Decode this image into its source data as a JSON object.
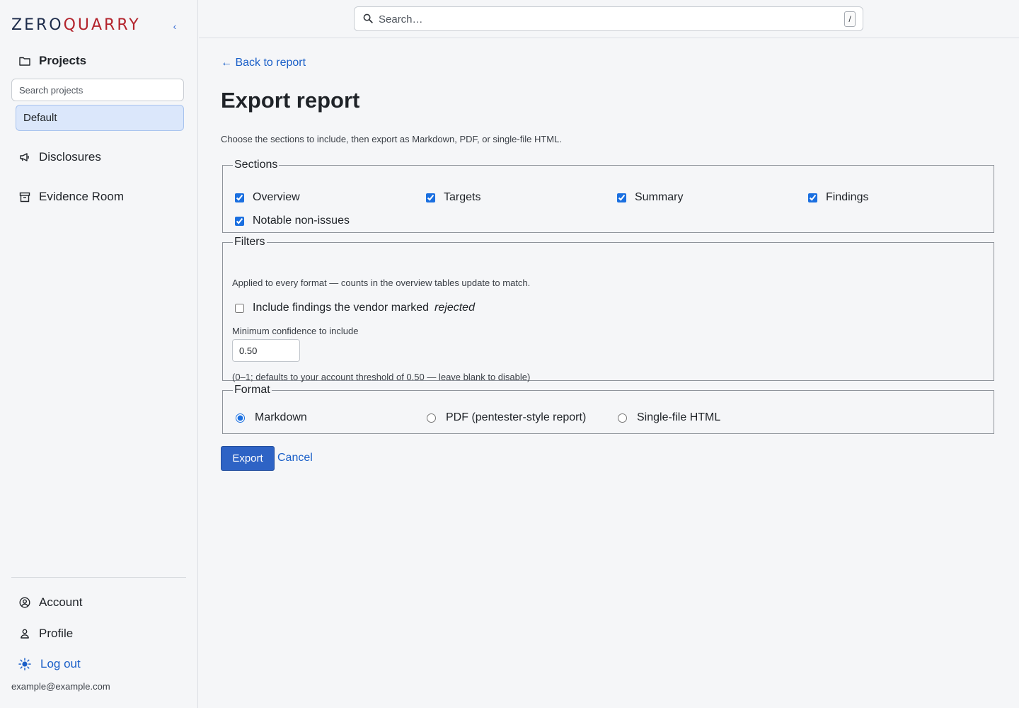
{
  "brand": {
    "zero": "ZERO",
    "quarry": "QUARRY",
    "collapse_glyph": "‹"
  },
  "sidebar": {
    "projects_label": "Projects",
    "project_search_placeholder": "Search projects",
    "projects": [
      {
        "label": "Default",
        "selected": true
      }
    ],
    "disclosures_label": "Disclosures",
    "evidence_room_label": "Evidence Room",
    "account_label": "Account",
    "profile_label": "Profile",
    "logout_label": "Log out",
    "user_email": "example@example.com"
  },
  "topbar": {
    "search_placeholder": "Search…",
    "shortcut_key": "/"
  },
  "main": {
    "back_link": "← Back to report",
    "title": "Export report",
    "intro": "Choose the sections to include, then export as Markdown, PDF, or single-file HTML.",
    "sections": {
      "legend": "Sections",
      "items": [
        {
          "label": "Overview",
          "checked": true
        },
        {
          "label": "Targets",
          "checked": true
        },
        {
          "label": "Summary",
          "checked": true
        },
        {
          "label": "Findings",
          "checked": true
        },
        {
          "label": "Notable non-issues",
          "checked": true
        }
      ]
    },
    "filters": {
      "legend": "Filters",
      "note": "Applied to every format — counts in the overview tables update to match.",
      "include_rejected_label": "Include findings the vendor marked",
      "include_rejected_emphasis": "rejected",
      "include_rejected_checked": false,
      "min_confidence_label": "Minimum confidence to include",
      "min_confidence_value": "0.50",
      "min_confidence_help": "(0–1; defaults to your account threshold of 0.50 — leave blank to disable)"
    },
    "format": {
      "legend": "Format",
      "options": [
        {
          "label": "Markdown",
          "selected": true
        },
        {
          "label": "PDF (pentester-style report)",
          "selected": false
        },
        {
          "label": "Single-file HTML",
          "selected": false
        }
      ]
    },
    "export_label": "Export",
    "cancel_label": "Cancel"
  },
  "colors": {
    "accent": "#2e63c5",
    "link": "#1a5fc8",
    "brand_dark": "#1c2b4a",
    "brand_red": "#b3232c",
    "selected_bg": "#dbe7fb"
  }
}
